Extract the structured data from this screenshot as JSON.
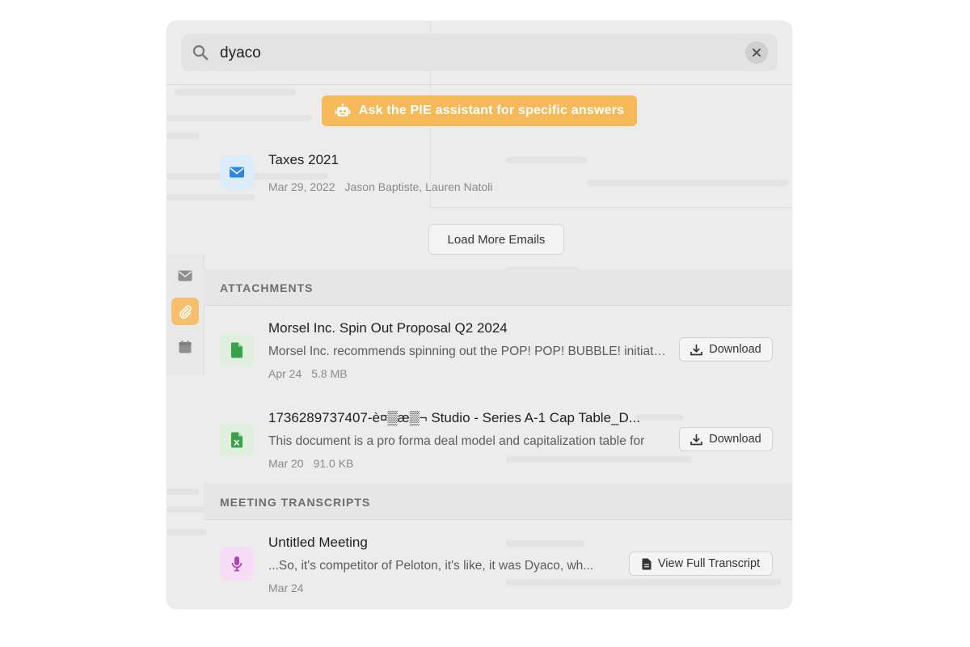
{
  "search": {
    "value": "dyaco",
    "placeholder": ""
  },
  "assistant": {
    "label": "Ask the PIE assistant for specific answers",
    "color": "#f5b95a"
  },
  "emails": [
    {
      "subject": "Taxes 2021",
      "date": "Mar 29, 2022",
      "participants": "Jason Baptiste, Lauren Natoli",
      "icon": "envelope-icon"
    }
  ],
  "load_more_label": "Load More Emails",
  "side_tabs": [
    {
      "icon": "envelope-icon",
      "active": false
    },
    {
      "icon": "paperclip-icon",
      "active": true
    },
    {
      "icon": "calendar-icon",
      "active": false
    }
  ],
  "attachments": {
    "header": "ATTACHMENTS",
    "items": [
      {
        "title": "Morsel Inc. Spin Out Proposal Q2 2024",
        "snippet": "Morsel Inc. recommends spinning out the POP! POP! BUBBLE! initiative",
        "date": "Apr 24",
        "size": "5.8 MB",
        "icon": "document-icon",
        "action": "Download"
      },
      {
        "title": "1736289737407-è¤▒æ▒¬ Studio - Series A-1 Cap Table_D...",
        "snippet": "This document is a pro forma deal model and capitalization table for",
        "date": "Mar 20",
        "size": "91.0 KB",
        "icon": "spreadsheet-icon",
        "action": "Download"
      }
    ]
  },
  "transcripts": {
    "header": "MEETING TRANSCRIPTS",
    "items": [
      {
        "title": "Untitled Meeting",
        "snippet": "...So, it's competitor of Peloton, it's like, it was Dyaco, wh...",
        "date": "Mar 24",
        "icon": "microphone-icon",
        "action": "View Full Transcript"
      }
    ]
  }
}
